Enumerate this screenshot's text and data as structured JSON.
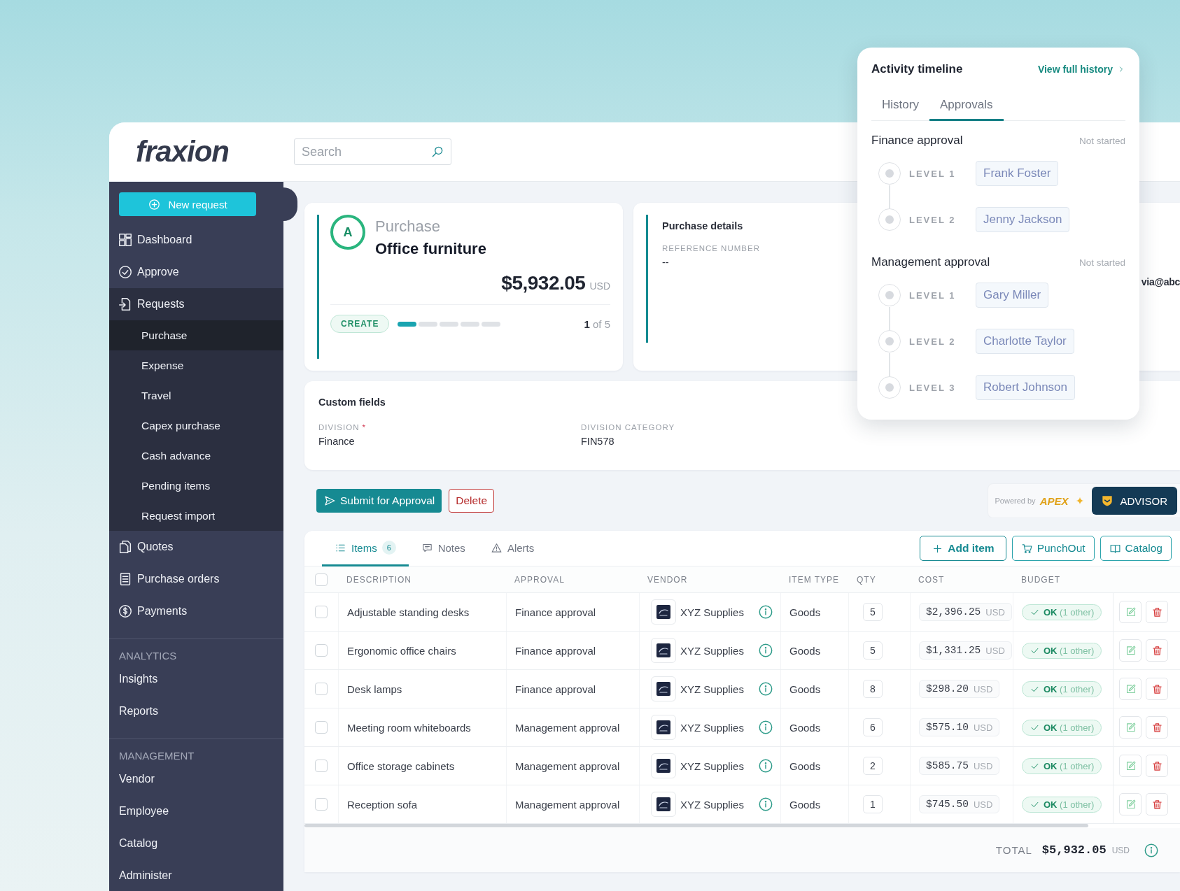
{
  "header": {
    "logo": "fraxion",
    "search": {
      "placeholder": "Search"
    }
  },
  "sidebar": {
    "new_request": "New request",
    "items": [
      {
        "label": "Dashboard",
        "selected": false
      },
      {
        "label": "Approve",
        "selected": false
      },
      {
        "label": "Requests",
        "selected": false,
        "expanded": true,
        "children": [
          {
            "label": "Purchase",
            "selected": true
          },
          {
            "label": "Expense",
            "selected": false
          },
          {
            "label": "Travel",
            "selected": false
          },
          {
            "label": "Capex purchase",
            "selected": false
          },
          {
            "label": "Cash advance",
            "selected": false
          },
          {
            "label": "Pending items",
            "selected": false
          },
          {
            "label": "Request import",
            "selected": false
          }
        ]
      },
      {
        "label": "Quotes",
        "selected": false
      },
      {
        "label": "Purchase orders",
        "selected": false
      },
      {
        "label": "Payments",
        "selected": false
      }
    ],
    "sections": [
      {
        "title": "ANALYTICS",
        "items": [
          {
            "label": "Insights",
            "selected": false
          },
          {
            "label": "Reports",
            "selected": false
          }
        ]
      },
      {
        "title": "MANAGEMENT",
        "items": [
          {
            "label": "Vendor",
            "selected": false
          },
          {
            "label": "Employee",
            "selected": false
          },
          {
            "label": "Catalog",
            "selected": false
          },
          {
            "label": "Administer",
            "selected": false
          }
        ]
      }
    ]
  },
  "purchase_card": {
    "avatar": "A",
    "type": "Purchase",
    "title": "Office furniture",
    "amount": "$5,932.05",
    "currency": "USD",
    "stage": "CREATE",
    "steps": [
      {
        "active": true
      },
      {
        "active": false
      },
      {
        "active": false
      },
      {
        "active": false
      },
      {
        "active": false
      }
    ],
    "step_text": "**1** of 5"
  },
  "details_card": {
    "title": "Purchase details",
    "fields": [
      {
        "label": "REFERENCE NUMBER",
        "value": "--"
      }
    ],
    "cut_value": "via@abc"
  },
  "custom_fields": {
    "title": "Custom fields",
    "fields": [
      {
        "label": "DIVISION",
        "marker": "*",
        "value": "Finance"
      },
      {
        "label": "DIVISION CATEGORY",
        "value": "FIN578"
      }
    ]
  },
  "actions": {
    "submit": "Submit for Approval",
    "delete": "Delete",
    "powered_by": "Powered by",
    "apex": "APEX",
    "advisor": "ADVISOR"
  },
  "items_panel": {
    "tabs": [
      {
        "label": "Items",
        "count": "6",
        "selected": true
      },
      {
        "label": "Notes",
        "selected": false
      },
      {
        "label": "Alerts",
        "selected": false
      }
    ],
    "tools": [
      "Add item",
      "PunchOut",
      "Catalog"
    ],
    "table": {
      "all_checked": false,
      "columns": [
        "DESCRIPTION",
        "APPROVAL",
        "VENDOR",
        "ITEM TYPE",
        "QTY",
        "COST",
        "BUDGET"
      ],
      "rows": [
        {
          "checked": false,
          "description": "Adjustable standing desks",
          "approval": "Finance approval",
          "vendor": "XYZ Supplies",
          "item_type": "Goods",
          "qty": "5",
          "cost": "$2,396.25",
          "currency": "USD",
          "budget": "**OK** (1 other)"
        },
        {
          "checked": false,
          "description": "Ergonomic office chairs",
          "approval": "Finance approval",
          "vendor": "XYZ Supplies",
          "item_type": "Goods",
          "qty": "5",
          "cost": "$1,331.25",
          "currency": "USD",
          "budget": "**OK** (1 other)"
        },
        {
          "checked": false,
          "description": "Desk lamps",
          "approval": "Finance approval",
          "vendor": "XYZ Supplies",
          "item_type": "Goods",
          "qty": "8",
          "cost": "$298.20",
          "currency": "USD",
          "budget": "**OK** (1 other)"
        },
        {
          "checked": false,
          "description": "Meeting room whiteboards",
          "approval": "Management approval",
          "vendor": "XYZ Supplies",
          "item_type": "Goods",
          "qty": "6",
          "cost": "$575.10",
          "currency": "USD",
          "budget": "**OK** (1 other)"
        },
        {
          "checked": false,
          "description": "Office storage cabinets",
          "approval": "Management approval",
          "vendor": "XYZ Supplies",
          "item_type": "Goods",
          "qty": "2",
          "cost": "$585.75",
          "currency": "USD",
          "budget": "**OK** (1 other)"
        },
        {
          "checked": false,
          "description": "Reception sofa",
          "approval": "Management approval",
          "vendor": "XYZ Supplies",
          "item_type": "Goods",
          "qty": "1",
          "cost": "$745.50",
          "currency": "USD",
          "budget": "**OK** (1 other)"
        }
      ]
    },
    "total": {
      "label": "TOTAL",
      "amount": "$5,932.05",
      "currency": "USD"
    }
  },
  "timeline": {
    "title": "Activity timeline",
    "link": "View full history",
    "tabs": [
      {
        "label": "History",
        "selected": false
      },
      {
        "label": "Approvals",
        "selected": true
      }
    ],
    "groups": [
      {
        "name": "Finance approval",
        "status": "Not started",
        "levels": [
          {
            "label": "LEVEL 1",
            "approver": "Frank Foster"
          },
          {
            "label": "LEVEL 2",
            "approver": "Jenny Jackson"
          }
        ]
      },
      {
        "name": "Management approval",
        "status": "Not started",
        "levels": [
          {
            "label": "LEVEL 1",
            "approver": "Gary Miller"
          },
          {
            "label": "LEVEL 2",
            "approver": "Charlotte Taylor"
          },
          {
            "label": "LEVEL 3",
            "approver": "Robert Johnson"
          }
        ]
      }
    ]
  }
}
